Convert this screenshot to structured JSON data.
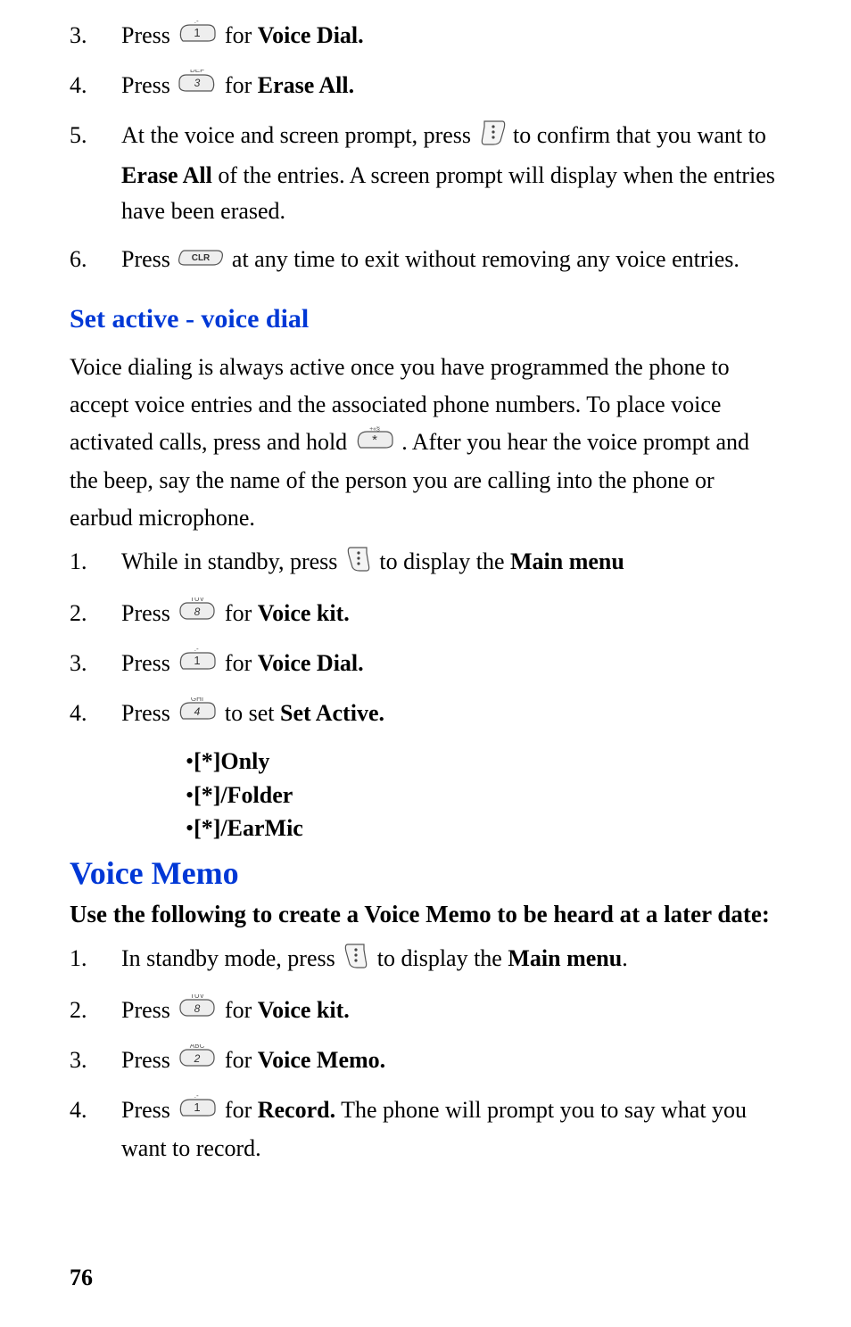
{
  "top_steps": [
    {
      "n": "3.",
      "pre": "Press",
      "icon": "key-1",
      "post_a": " for ",
      "bold": "Voice Dial."
    },
    {
      "n": "4.",
      "pre": "Press",
      "icon": "key-3-def",
      "post_a": "for ",
      "bold": "Erase All."
    },
    {
      "n": "5.",
      "pre": "At the voice and screen prompt, press  ",
      "icon": "soft-i",
      "post_a": "  to confirm that you want to ",
      "bold": "Erase All",
      "tail": " of the entries. A screen prompt will display when the entries have been erased."
    },
    {
      "n": "6.",
      "pre": "Press  ",
      "icon": "key-clr",
      "post_a": "  at any time to exit without removing any voice entries."
    }
  ],
  "section1_title": "Set active - voice dial",
  "section1_para_a": "Voice dialing is always active once you have programmed the phone to accept voice entries and the associated phone numbers. To place voice activated calls, press and hold ",
  "section1_para_b": " . After you hear the voice prompt and the beep, say the name of the person you are calling into the phone or earbud microphone.",
  "sa_steps": [
    {
      "n": "1.",
      "pre": "While in standby, press ",
      "icon": "soft-i-left",
      "post_a": "  to display the ",
      "bold": "Main menu"
    },
    {
      "n": "2.",
      "pre": "Press",
      "icon": "key-8-tuv",
      "post_a": "  for ",
      "bold": "Voice kit."
    },
    {
      "n": "3.",
      "pre": "Press",
      "icon": "key-1",
      "post_a": "  for ",
      "bold": "Voice Dial."
    },
    {
      "n": "4.",
      "pre": "Press",
      "icon": "key-4-ghi",
      "post_a": "  to set ",
      "bold": "Set Active."
    }
  ],
  "bullets": [
    "[*]Only",
    "[*]/Folder",
    "[*]/EarMic"
  ],
  "section2_title": "Voice Memo",
  "section2_sub": "Use the following to create a Voice Memo to be heard at a later date:",
  "vm_steps": [
    {
      "n": "1.",
      "pre": "In standby mode, press ",
      "icon": "soft-i-left",
      "post_a": "  to display the ",
      "bold": "Main menu",
      "tail2": "."
    },
    {
      "n": "2.",
      "pre": "Press",
      "icon": "key-8-tuv",
      "post_a": " for ",
      "bold": "Voice kit."
    },
    {
      "n": "3.",
      "pre": "Press",
      "icon": "key-2-abc",
      "post_a": "for ",
      "bold": "Voice Memo."
    },
    {
      "n": "4.",
      "pre": "Press",
      "icon": "key-1",
      "post_a": " for ",
      "bold": "Record.",
      "tail": " The phone will prompt you to say what you want to record."
    }
  ],
  "page_number": "76"
}
